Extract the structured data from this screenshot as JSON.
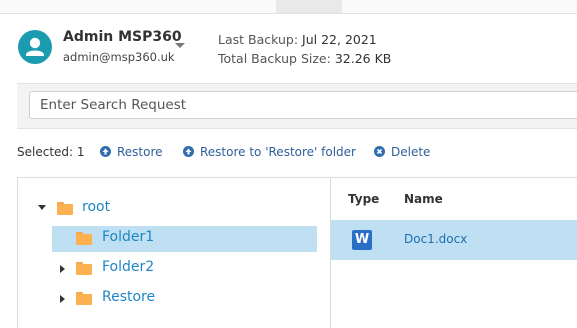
{
  "user": {
    "name": "Admin MSP360",
    "email": "admin@msp360.uk"
  },
  "backup_info": {
    "last_backup_label": "Last Backup:",
    "last_backup_value": "Jul 22, 2021",
    "total_size_label": "Total Backup Size:",
    "total_size_value": "32.26 KB"
  },
  "search": {
    "placeholder": "Enter Search Request"
  },
  "actions": {
    "selected_label": "Selected:",
    "selected_count": "1",
    "restore": "Restore",
    "restore_to_folder": "Restore to 'Restore' folder",
    "delete": "Delete"
  },
  "tree": {
    "items": [
      {
        "label": "root",
        "expanded": true,
        "selected": false
      },
      {
        "label": "Folder1",
        "expanded": false,
        "selected": true
      },
      {
        "label": "Folder2",
        "expanded": false,
        "selected": false
      },
      {
        "label": "Restore",
        "expanded": false,
        "selected": false
      }
    ]
  },
  "files": {
    "columns": [
      "Type",
      "Name"
    ],
    "rows": [
      {
        "type_icon": "word-document-icon",
        "type_glyph": "W",
        "name": "Doc1.docx",
        "selected": true
      }
    ]
  },
  "colors": {
    "accent": "#1a9bb0",
    "link": "#1f86c4",
    "selection": "#bfe0f3",
    "folder": "#fbb14f"
  }
}
